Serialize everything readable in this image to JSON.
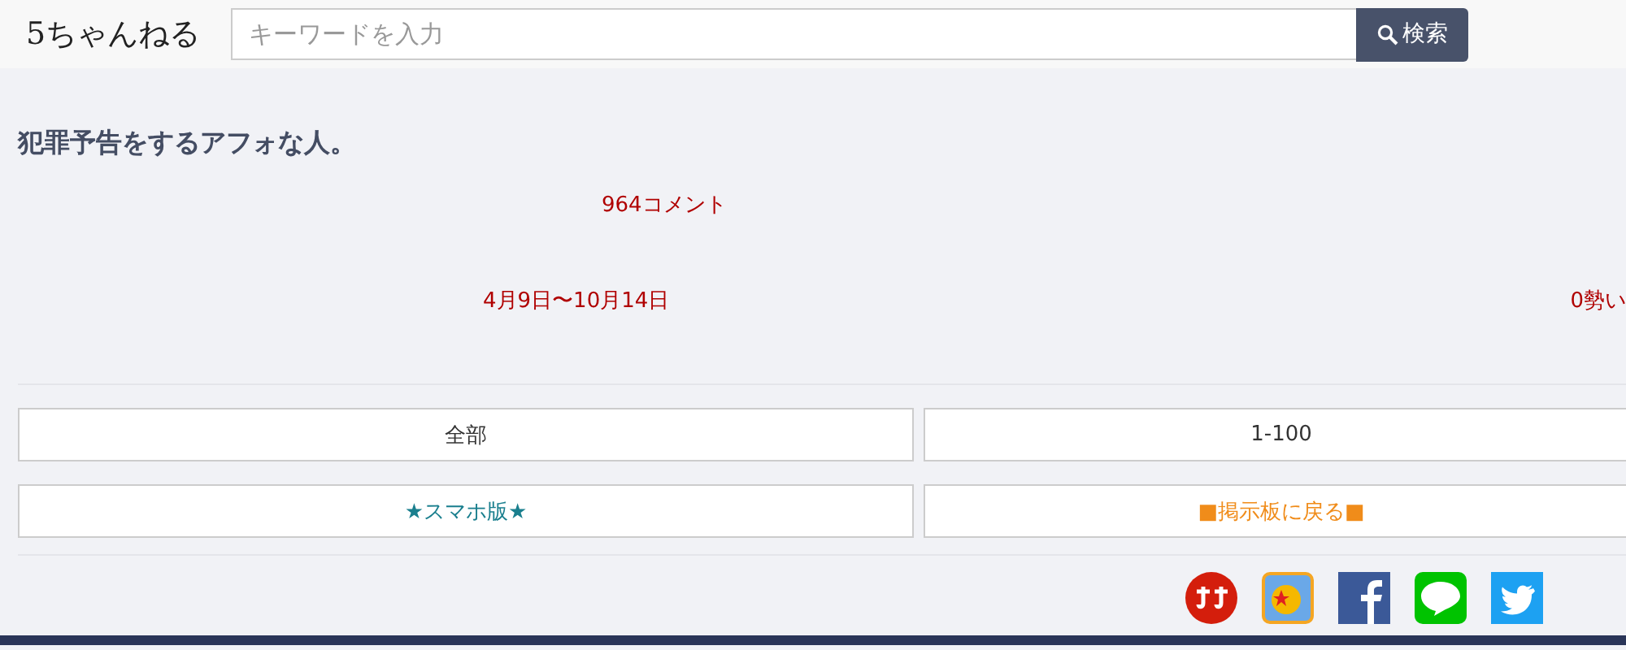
{
  "header": {
    "logo": "5ちゃんねる",
    "search": {
      "placeholder": "キーワードを入力"
    },
    "search_button": "検索"
  },
  "thread": {
    "title": "犯罪予告をするアフォな人。",
    "comments": "964コメント",
    "dates": "4月9日〜10月14日",
    "momentum": "0勢い"
  },
  "links": [
    {
      "label": "全部",
      "kind": "plain"
    },
    {
      "label": "1-100",
      "kind": "plain"
    },
    {
      "label": "★スマホ版★",
      "kind": "mobile"
    },
    {
      "label": "■掲示板に戻る■",
      "kind": "back"
    }
  ],
  "share": [
    {
      "kind": "round"
    },
    {
      "kind": "app"
    },
    {
      "kind": "facebook"
    },
    {
      "kind": "line"
    },
    {
      "kind": "twitter"
    }
  ]
}
